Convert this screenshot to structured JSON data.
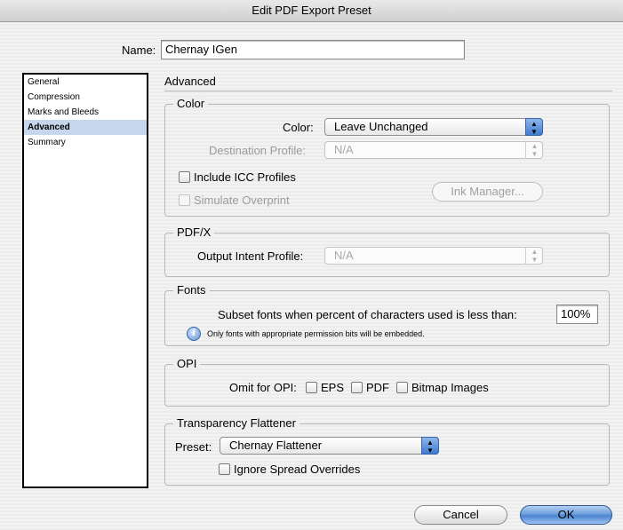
{
  "window": {
    "title": "Edit PDF Export Preset"
  },
  "name_field": {
    "label": "Name:",
    "value": "Chernay IGen"
  },
  "sidebar": {
    "items": [
      {
        "label": "General"
      },
      {
        "label": "Compression"
      },
      {
        "label": "Marks and Bleeds"
      },
      {
        "label": "Advanced"
      },
      {
        "label": "Summary"
      }
    ]
  },
  "panel": {
    "title": "Advanced"
  },
  "color_group": {
    "title": "Color",
    "color_label": "Color:",
    "color_value": "Leave Unchanged",
    "destination_label": "Destination Profile:",
    "destination_value": "N/A",
    "include_icc_label": "Include ICC Profiles",
    "simulate_overprint_label": "Simulate Overprint",
    "ink_manager_label": "Ink Manager..."
  },
  "pdfx_group": {
    "title": "PDF/X",
    "output_intent_label": "Output Intent Profile:",
    "output_intent_value": "N/A"
  },
  "fonts_group": {
    "title": "Fonts",
    "subset_label": "Subset fonts when percent of characters used is less than:",
    "subset_value": "100%",
    "info_text": "Only fonts with appropriate permission bits will be embedded."
  },
  "opi_group": {
    "title": "OPI",
    "omit_label": "Omit for OPI:",
    "eps_label": "EPS",
    "pdf_label": "PDF",
    "bitmap_label": "Bitmap Images"
  },
  "transparency_group": {
    "title": "Transparency Flattener",
    "preset_label": "Preset:",
    "preset_value": "Chernay Flattener",
    "ignore_overrides_label": "Ignore Spread Overrides"
  },
  "buttons": {
    "cancel_label": "Cancel",
    "ok_label": "OK"
  },
  "colors": {
    "selection": "#c6d6ec",
    "default_button": "#6e9fdc"
  }
}
